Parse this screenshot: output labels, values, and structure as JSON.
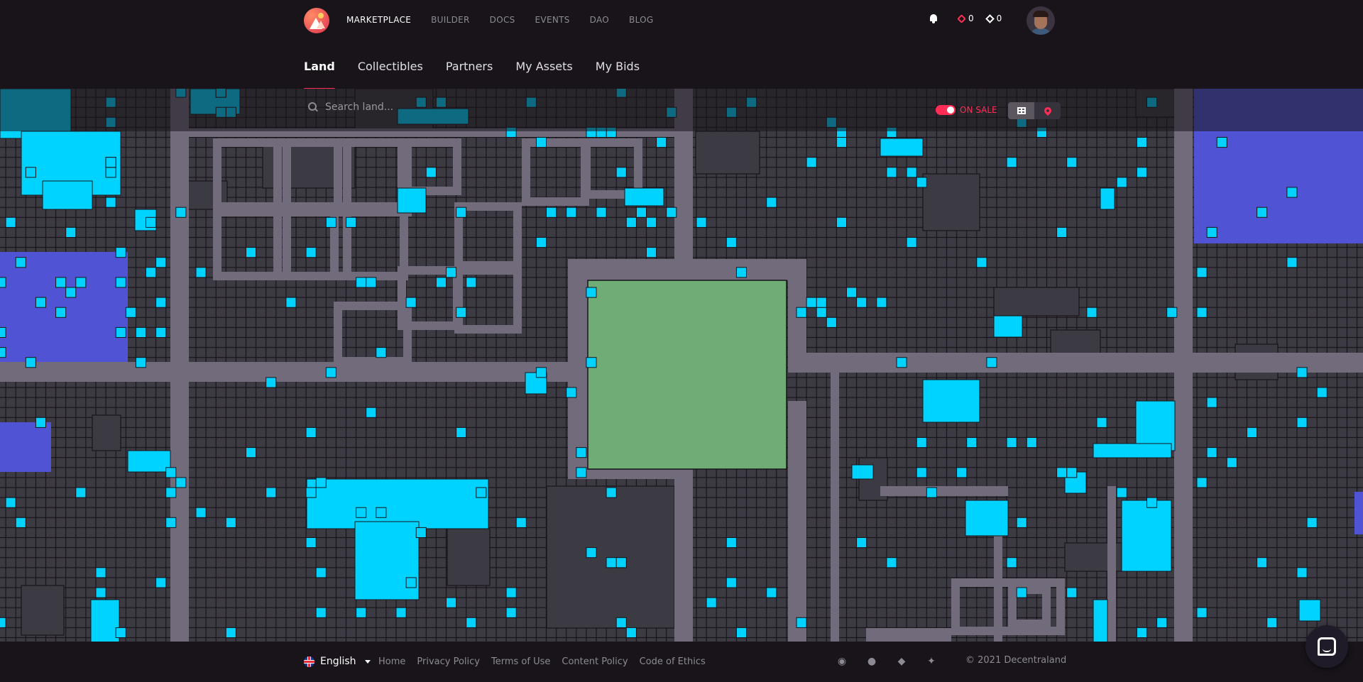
{
  "nav": {
    "links": [
      "MARKETPLACE",
      "BUILDER",
      "DOCS",
      "EVENTS",
      "DAO",
      "BLOG"
    ],
    "mana_balance_l2": "0",
    "mana_balance_l1": "0"
  },
  "tabs": [
    "Land",
    "Collectibles",
    "Partners",
    "My Assets",
    "My Bids"
  ],
  "map": {
    "search_placeholder": "Search land...",
    "on_sale_label": "ON SALE",
    "colors": {
      "background": "#3c3a42",
      "road": "#716b7c",
      "parcel": "#3c3a42",
      "parcel_border": "#18141a",
      "on_sale": "#00d3ff",
      "district": "#5054d4",
      "plaza": "#70ac76"
    }
  },
  "footer": {
    "language": "English",
    "links": [
      "Home",
      "Privacy Policy",
      "Terms of Use",
      "Content Policy",
      "Code of Ethics"
    ],
    "copyright": "© 2021 Decentraland"
  }
}
